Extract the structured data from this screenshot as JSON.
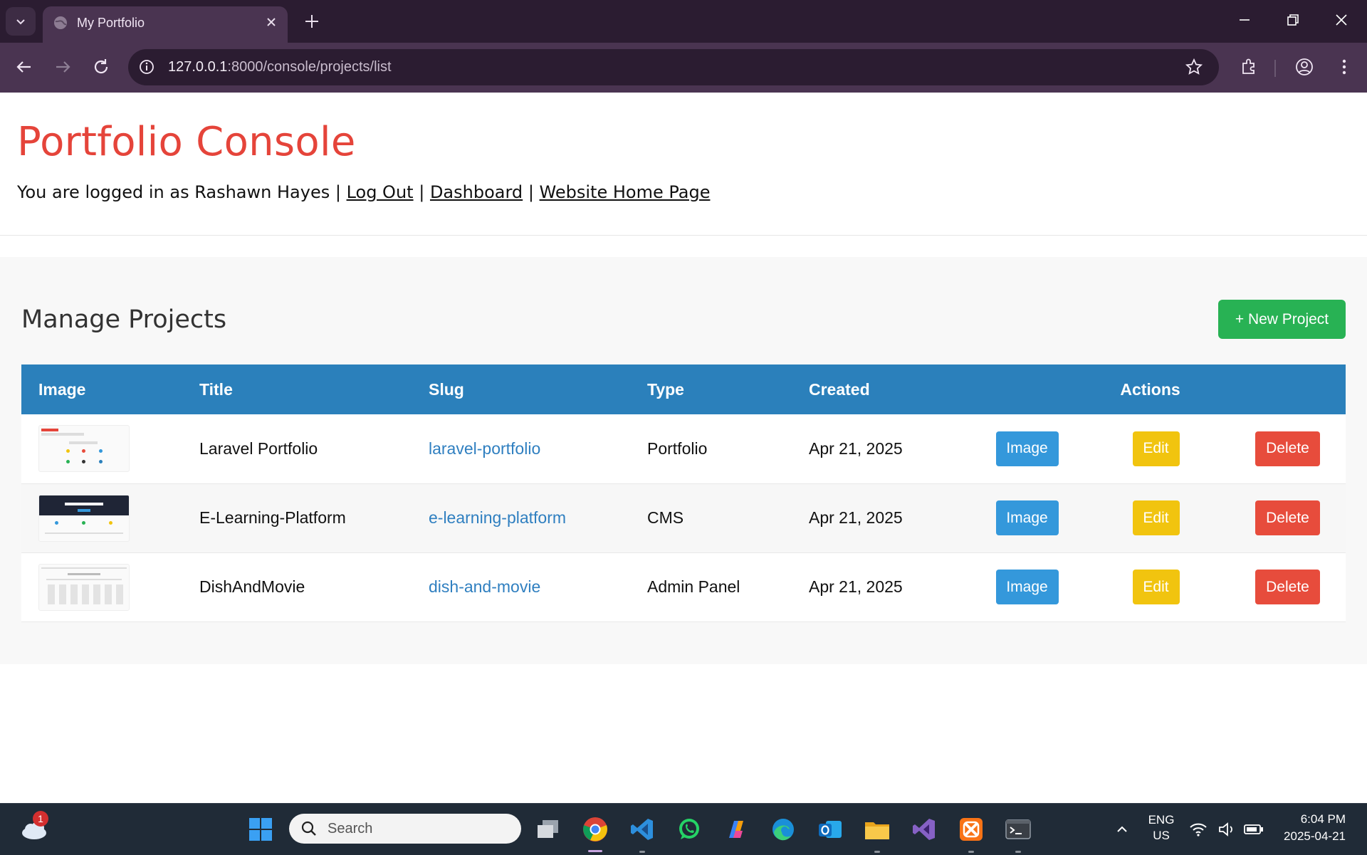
{
  "browser": {
    "tab_title": "My Portfolio",
    "url_host": "127.0.0.1",
    "url_rest": ":8000/console/projects/list"
  },
  "header": {
    "site_title": "Portfolio Console",
    "logged_in_prefix": "You are logged in as Rashawn Hayes |",
    "logout_link": "Log Out",
    "sep1": "|",
    "dashboard_link": "Dashboard",
    "sep2": "|",
    "home_link": "Website Home Page"
  },
  "main": {
    "section_title": "Manage Projects",
    "new_project_label": "+ New Project",
    "columns": [
      "Image",
      "Title",
      "Slug",
      "Type",
      "Created",
      "Actions"
    ],
    "rows": [
      {
        "title": "Laravel Portfolio",
        "slug": "laravel-portfolio",
        "type": "Portfolio",
        "created": "Apr 21, 2025"
      },
      {
        "title": "E-Learning-Platform",
        "slug": "e-learning-platform",
        "type": "CMS",
        "created": "Apr 21, 2025"
      },
      {
        "title": "DishAndMovie",
        "slug": "dish-and-movie",
        "type": "Admin Panel",
        "created": "Apr 21, 2025"
      }
    ],
    "actions": {
      "image": "Image",
      "edit": "Edit",
      "delete": "Delete"
    }
  },
  "taskbar": {
    "search_placeholder": "Search",
    "weather_badge": "1",
    "lang_top": "ENG",
    "lang_bottom": "US",
    "time": "6:04 PM",
    "date": "2025-04-21"
  },
  "colors": {
    "title_red": "#e5443a",
    "table_header_blue": "#2b80bb",
    "new_project_green": "#28b254",
    "image_button_blue": "#3498db",
    "edit_button_yellow": "#f1c40f",
    "delete_button_red": "#e74c3c",
    "link_blue": "#2f7fc0"
  }
}
